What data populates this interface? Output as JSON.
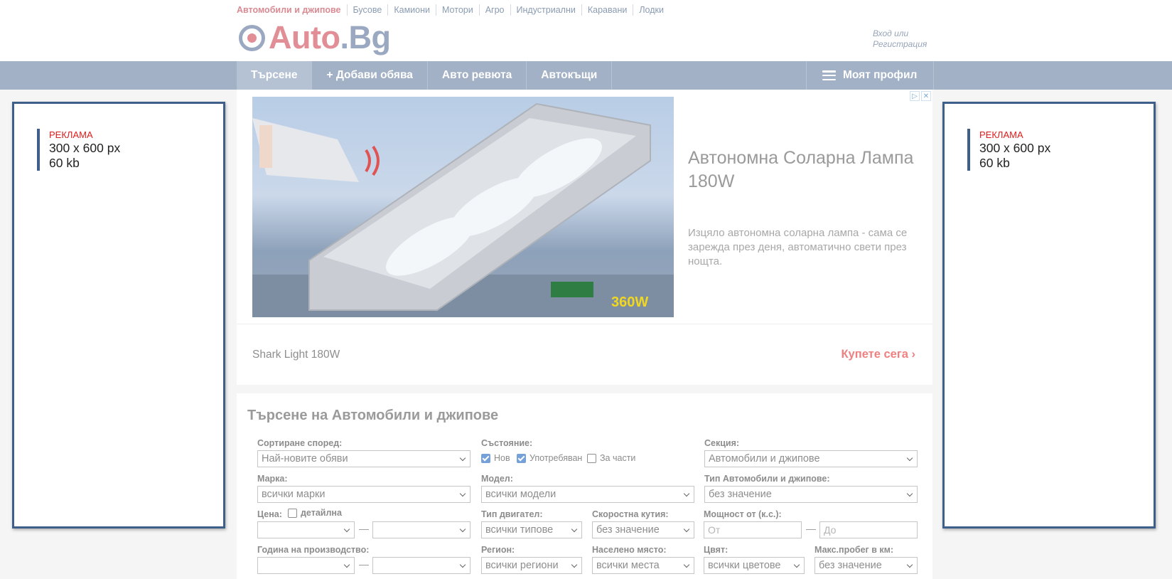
{
  "categories": [
    "Автомобили и джипове",
    "Бусове",
    "Камиони",
    "Мотори",
    "Агро",
    "Индустриални",
    "Каравани",
    "Лодки"
  ],
  "logo": {
    "main": "Auto",
    "dot": ".",
    "suffix": "Bg"
  },
  "login": {
    "line1": "Вход или",
    "line2": "Регистрация"
  },
  "nav": {
    "search": "Търсене",
    "add": "+ Добави обява",
    "reviews": "Авто ревюта",
    "parts": "Автокъщи",
    "profile": "Моят профил"
  },
  "side_ad": {
    "label": "РЕКЛАМА",
    "size": "300 x 600 px",
    "weight": "60 kb"
  },
  "promo": {
    "close_icons": [
      "▷",
      "✕"
    ],
    "title": "Автономна Соларна Лампа 180W",
    "description": "Изцяло автономна соларна лампа - сама се зарежда през деня, автоматично свети през нощта.",
    "brand": "Shark Light 180W",
    "cta": "Купете сега",
    "image_text": "360W"
  },
  "search": {
    "title": "Търсене на Автомобили и джипове",
    "sort_label": "Сортиране според:",
    "sort_value": "Най-новите обяви",
    "condition_label": "Състояние:",
    "conditions": [
      {
        "label": "Нов",
        "checked": true
      },
      {
        "label": "Употребяван",
        "checked": true
      },
      {
        "label": "За части",
        "checked": false
      }
    ],
    "section_label": "Секция:",
    "section_value": "Автомобили и джипове",
    "make_label": "Марка:",
    "make_value": "всички марки",
    "model_label": "Модел:",
    "model_value": "всички модели",
    "type_label": "Тип Автомобили и джипове:",
    "type_value": "без значение",
    "price_label": "Цена:",
    "price_detail": "детайлна",
    "engine_label": "Тип двигател:",
    "engine_value": "всички типове",
    "gearbox_label": "Скоростна кутия:",
    "gearbox_value": "без значение",
    "power_label": "Мощност от (к.с.):",
    "power_from": "От",
    "power_to": "До",
    "year_label": "Година на производство:",
    "region_label": "Регион:",
    "region_value": "всички региони",
    "place_label": "Населено място:",
    "place_value": "всички места",
    "color_label": "Цвят:",
    "color_value": "всички цветове",
    "mileage_label": "Макс.пробег в км:",
    "mileage_value": "без значение",
    "dash": "—"
  }
}
